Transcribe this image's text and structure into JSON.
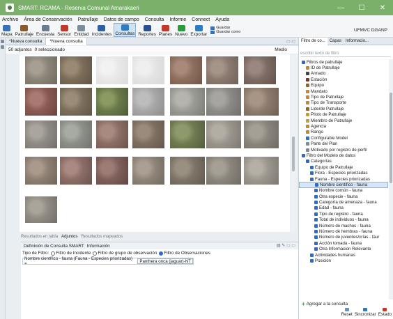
{
  "window": {
    "title": "SMART: RCAMA - Reserva Comunal Amarakaeri",
    "controls": [
      "—",
      "☐",
      "✕"
    ]
  },
  "menu": [
    "Archivo",
    "Área de Conservación",
    "Patrullaje",
    "Datos de campo",
    "Consulta",
    "Informe",
    "Connect",
    "Ayuda"
  ],
  "toolbar": {
    "buttons": [
      {
        "label": "Mapa",
        "icon": "map-icon",
        "color": "#3b6fb6"
      },
      {
        "label": "Patrullaje",
        "icon": "footprints-icon",
        "color": "#8a5a2b"
      },
      {
        "label": "Encuesta",
        "icon": "clipboard-icon",
        "color": "#6b7c8f"
      },
      {
        "label": "Sensor",
        "icon": "sensor-icon",
        "color": "#c0392b"
      },
      {
        "label": "Entidad",
        "icon": "entity-icon",
        "color": "#7d8c9c"
      },
      {
        "label": "Incidentes",
        "icon": "incident-icon",
        "color": "#2f5f9e"
      },
      {
        "label": "Consultas",
        "icon": "query-icon",
        "color": "#2f7bc2",
        "active": true
      },
      {
        "label": "Reportes",
        "icon": "report-icon",
        "color": "#2b4f8a"
      },
      {
        "label": "Planes",
        "icon": "plan-icon",
        "color": "#c0392b"
      },
      {
        "label": "Nuevo",
        "icon": "plus-icon",
        "color": "#2a9a3a"
      },
      {
        "label": "Exportar",
        "icon": "export-icon",
        "color": "#2f7bc2"
      }
    ],
    "save": "Guardar",
    "save_as": "Guardar como",
    "user_label": "UFMVC DGANP"
  },
  "tabs": [
    {
      "label": "*Nueva consulta",
      "active": false
    },
    {
      "label": "*Nueva consulta",
      "active": true
    }
  ],
  "status": {
    "count": "50 adjuntos",
    "selected": "0 seleccionado",
    "size": "Medio"
  },
  "results_tabs": [
    "Resultados en tabla",
    "Adjuntos",
    "Resultados mapeados"
  ],
  "definition": {
    "tabs": [
      "Definición de Consulta SMART",
      "Información"
    ],
    "filter_type_label": "Tipo de Filtro:",
    "filter_options": [
      {
        "label": "Filtro de Incidente",
        "checked": false
      },
      {
        "label": "Filtro de grupo de observación",
        "checked": false
      },
      {
        "label": "Filtro de Observaciones",
        "checked": true
      }
    ],
    "condition_field": "Nombre científico - fauna (Fauna - Especies priorizadas) =",
    "condition_value": "Panthera onca (jaguar)-NT"
  },
  "right_panel": {
    "tabs": [
      "Filtro de co...",
      "Capas",
      "Informacio..."
    ],
    "search_placeholder": "escribir texto de filtro",
    "tree": [
      {
        "label": "Filtros de patrullaje",
        "level": 0,
        "color": "#2d6bc7"
      },
      {
        "label": "ID de Patrullaje",
        "level": 1,
        "color": "#c08a2a"
      },
      {
        "label": "Armado",
        "level": 1,
        "color": "#444444"
      },
      {
        "label": "Estación",
        "level": 1,
        "color": "#6b3b2b"
      },
      {
        "label": "Equipo",
        "level": 1,
        "color": "#8a6a2a"
      },
      {
        "label": "Mandato",
        "level": 1,
        "color": "#c08a2a"
      },
      {
        "label": "Tipo de Patrullaje",
        "level": 1,
        "color": "#c08a2a"
      },
      {
        "label": "Tipo de Transporte",
        "level": 1,
        "color": "#c08a2a"
      },
      {
        "label": "Liderde Patrullaje",
        "level": 1,
        "color": "#8a6a2a"
      },
      {
        "label": "Piloto de Patrullaje",
        "level": 1,
        "color": "#c0a030"
      },
      {
        "label": "Miembro de Patrullaje",
        "level": 1,
        "color": "#c0a030"
      },
      {
        "label": "Agencia",
        "level": 1,
        "color": "#c08a2a"
      },
      {
        "label": "Rango",
        "level": 1,
        "color": "#c08a2a"
      },
      {
        "label": "Configurable Model",
        "level": 1,
        "color": "#2d6bc7"
      },
      {
        "label": "Parte del Plan",
        "level": 1,
        "color": "#7a8da0"
      },
      {
        "label": "Motivado por registro de perfil",
        "level": 1,
        "color": "#7a8da0"
      },
      {
        "label": "Filtro del Modelo de datos",
        "level": 0,
        "color": "#2d6bc7"
      },
      {
        "label": "Categorías",
        "level": 1,
        "color": "#2d6bc7"
      },
      {
        "label": "Equipo de Patrullaje",
        "level": 2,
        "color": "#2d6bc7"
      },
      {
        "label": "Flora - Especies priorizadas",
        "level": 2,
        "color": "#2d6bc7"
      },
      {
        "label": "Fauna - Especies priorizadas",
        "level": 2,
        "color": "#2d6bc7"
      },
      {
        "label": "Nombre científico - fauna",
        "level": 3,
        "color": "#2d6bc7",
        "selected": true
      },
      {
        "label": "Nombre común - fauna",
        "level": 3,
        "color": "#2d6bc7"
      },
      {
        "label": "Otra especie - fauna",
        "level": 3,
        "color": "#2d6bc7"
      },
      {
        "label": "Categoría de amenaza - fauna",
        "level": 3,
        "color": "#2d6bc7"
      },
      {
        "label": "Edad - fauna",
        "level": 3,
        "color": "#2d6bc7"
      },
      {
        "label": "Tipo de registro - fauna",
        "level": 3,
        "color": "#2d6bc7"
      },
      {
        "label": "Total de individuos - fauna",
        "level": 3,
        "color": "#2d6bc7"
      },
      {
        "label": "Número de machos - fauna",
        "level": 3,
        "color": "#2d6bc7"
      },
      {
        "label": "Número de hembras - fauna",
        "level": 3,
        "color": "#2d6bc7"
      },
      {
        "label": "Número de juveniles/crías - faur",
        "level": 3,
        "color": "#2d6bc7"
      },
      {
        "label": "Acción tomada - fauna",
        "level": 3,
        "color": "#2d6bc7"
      },
      {
        "label": "Otra Informacion Relevante",
        "level": 3,
        "color": "#2d6bc7"
      },
      {
        "label": "Actividades humanas",
        "level": 2,
        "color": "#2d6bc7"
      },
      {
        "label": "Posición",
        "level": 2,
        "color": "#2d6bc7"
      }
    ],
    "add_label": "Agregar a la consulta",
    "bottom_buttons": [
      "Reset",
      "Sincronizar",
      "Estado"
    ]
  }
}
